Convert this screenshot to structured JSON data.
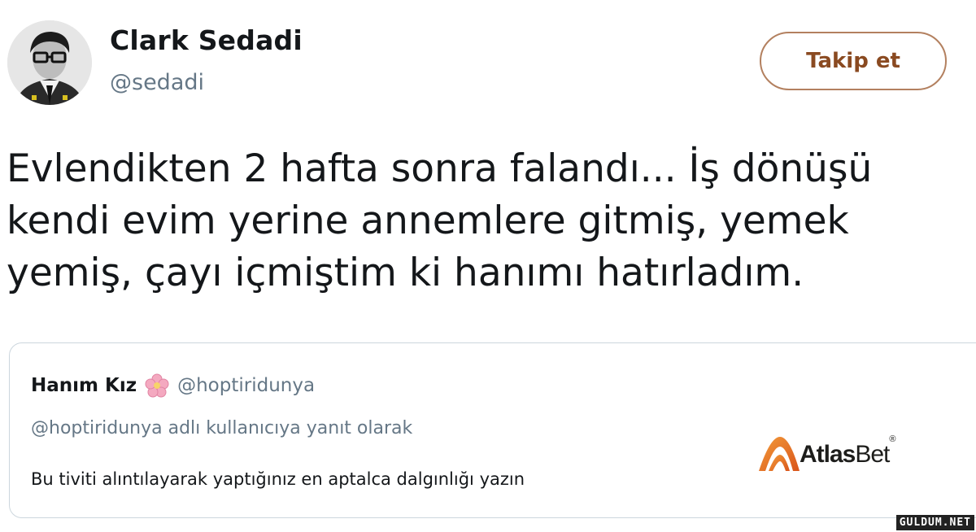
{
  "tweet": {
    "author_name": "Clark Sedadi",
    "author_handle": "@sedadi",
    "follow_label": "Takip et",
    "text": "Evlendikten 2 hafta sonra falandı... İş dönüşü\nkendi evim yerine annemlere gitmiş, yemek\nyemiş, çayı içmiştim ki hanımı hatırladım."
  },
  "quoted": {
    "author_name": "Hanım Kız",
    "emoji_icon": "cherry-blossom-icon",
    "author_handle": "@hoptiridunya",
    "reply_context": "@hoptiridunya adlı kullanıcıya yanıt olarak",
    "text": "Bu tiviti alıntılayarak yaptığınız en aptalca dalgınlığı yazın"
  },
  "branding": {
    "logo_word_bold": "Atlas",
    "logo_word_regular": "Bet",
    "logo_mark": "®",
    "logo_accent_color": "#e8731e",
    "watermark": "GULDUM.NET"
  },
  "colors": {
    "text": "#14171a",
    "muted": "#657786",
    "follow_border": "#b3805f",
    "card_border": "#ccd6dd"
  }
}
